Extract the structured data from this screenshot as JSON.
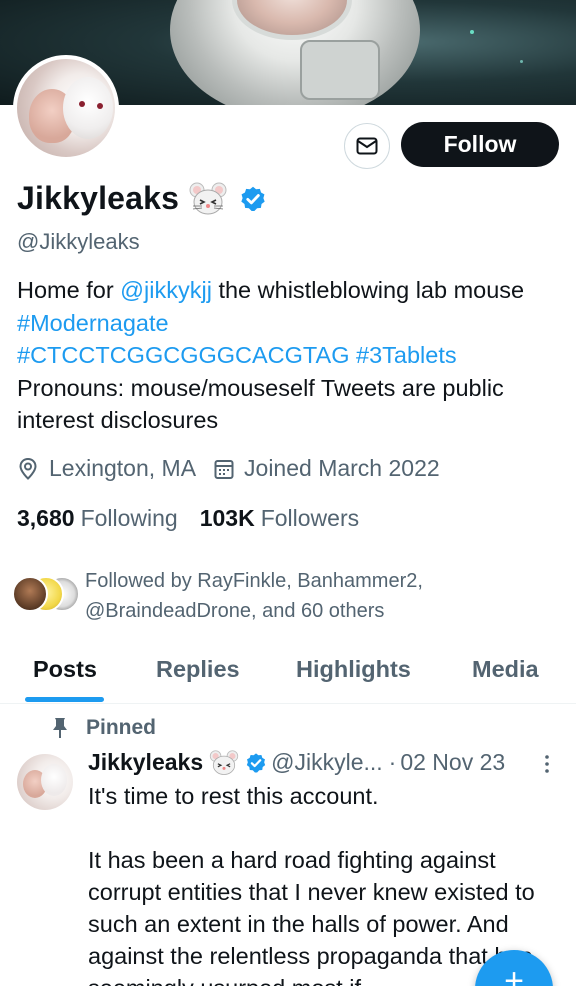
{
  "profile": {
    "name": "Jikkyleaks",
    "handle": "@Jikkyleaks",
    "bio": {
      "part1": "Home for ",
      "mention": "@jikkykjj",
      "part2": " the whistleblowing lab mouse  ",
      "hashtag1": "#Modernagate",
      "hashtag2": "#CTCCTCGGCGGGCACGTAG",
      "hashtag3": "#3Tablets",
      "part3": "Pronouns: mouse/mouseself Tweets are public interest disclosures"
    },
    "location": "Lexington, MA",
    "joined": "Joined March 2022",
    "following_count": "3,680",
    "following_label": "Following",
    "followers_count": "103K",
    "followers_label": "Followers",
    "followed_by": "Followed by RayFinkle, Banhammer2, @BraindeadDrone, and 60 others"
  },
  "actions": {
    "follow_label": "Follow",
    "message_icon": "envelope-icon"
  },
  "tabs": [
    {
      "label": "Posts",
      "active": true
    },
    {
      "label": "Replies",
      "active": false
    },
    {
      "label": "Highlights",
      "active": false
    },
    {
      "label": "Media",
      "active": false
    }
  ],
  "pinned_tweet": {
    "pinned_label": "Pinned",
    "author_name": "Jikkyleaks",
    "author_handle": "@Jikkyle...",
    "separator": "·",
    "date": "02 Nov 23",
    "text": "It's time to rest this account.\n\nIt has been a hard road fighting against corrupt entities that I never knew existed to such an extent in the halls of power. And against the relentless propaganda that has seemingly usurped most if"
  },
  "colors": {
    "accent": "#1d9bf0",
    "text_primary": "#0f1419",
    "text_secondary": "#536471",
    "follow_button_bg": "#0f1419"
  },
  "fab": {
    "label": "+"
  }
}
